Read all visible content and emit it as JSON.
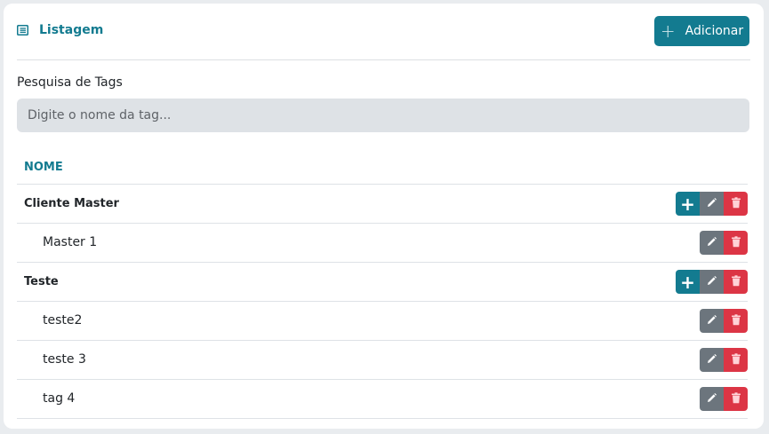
{
  "header": {
    "title": "Listagem",
    "add_label": "Adicionar"
  },
  "search": {
    "label": "Pesquisa de Tags",
    "placeholder": "Digite o nome da tag..."
  },
  "table": {
    "column_name": "NOME",
    "rows": [
      {
        "name": "Cliente Master",
        "parent": true
      },
      {
        "name": "Master 1",
        "parent": false
      },
      {
        "name": "Teste",
        "parent": true
      },
      {
        "name": "teste2",
        "parent": false
      },
      {
        "name": "teste 3",
        "parent": false
      },
      {
        "name": "tag 4",
        "parent": false
      }
    ]
  },
  "colors": {
    "accent": "#137b90",
    "edit": "#6c757d",
    "delete": "#dc3545"
  },
  "icons": {
    "list": "list-icon",
    "add": "plus-icon",
    "edit": "pencil-icon",
    "delete": "trash-icon"
  }
}
